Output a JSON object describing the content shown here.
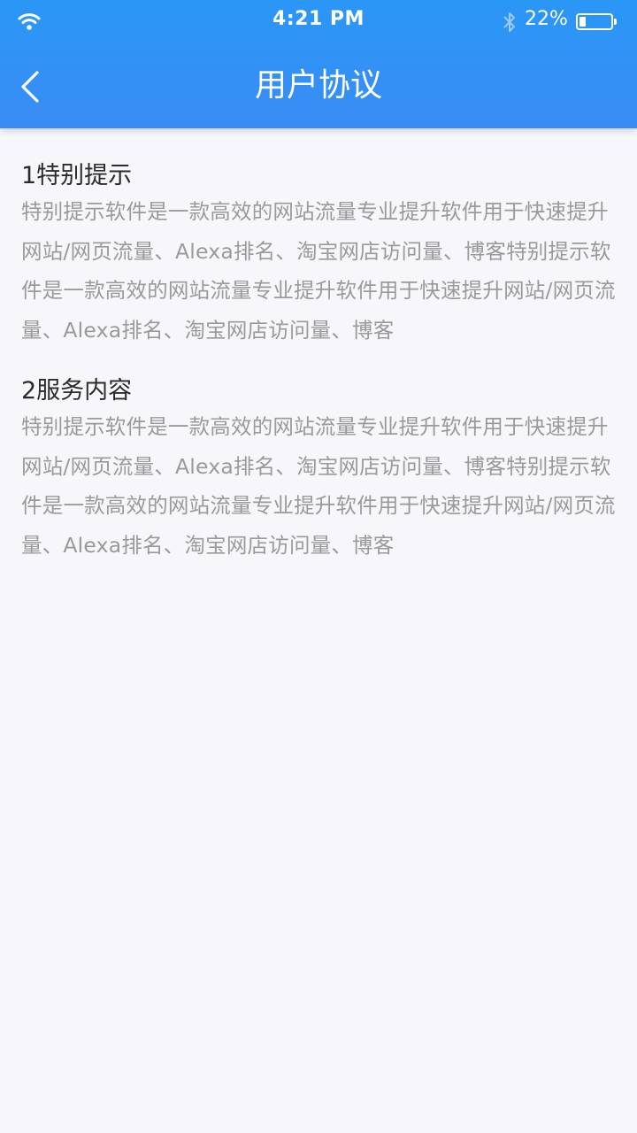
{
  "status_bar": {
    "time": "4:21 PM",
    "battery_percent": "22%",
    "battery_level": 0.22,
    "icons": [
      "wifi-icon",
      "bluetooth-icon",
      "battery-icon"
    ]
  },
  "nav": {
    "title": "用户协议",
    "back_icon": "chevron-left-icon"
  },
  "sections": [
    {
      "title": "1特别提示",
      "body": "特别提示软件是一款高效的网站流量专业提升软件用于快速提升网站/网页流量、Alexa排名、淘宝网店访问量、博客特别提示软件是一款高效的网站流量专业提升软件用于快速提升网站/网页流量、Alexa排名、淘宝网店访问量、博客"
    },
    {
      "title": "2服务内容",
      "body": "特别提示软件是一款高效的网站流量专业提升软件用于快速提升网站/网页流量、Alexa排名、淘宝网店访问量、博客特别提示软件是一款高效的网站流量专业提升软件用于快速提升网站/网页流量、Alexa排名、淘宝网店访问量、博客"
    }
  ],
  "colors": {
    "header": "#2a97f6",
    "background": "#f6f6fb",
    "title_text": "#2b2b2b",
    "body_text": "#9a9a9a"
  }
}
